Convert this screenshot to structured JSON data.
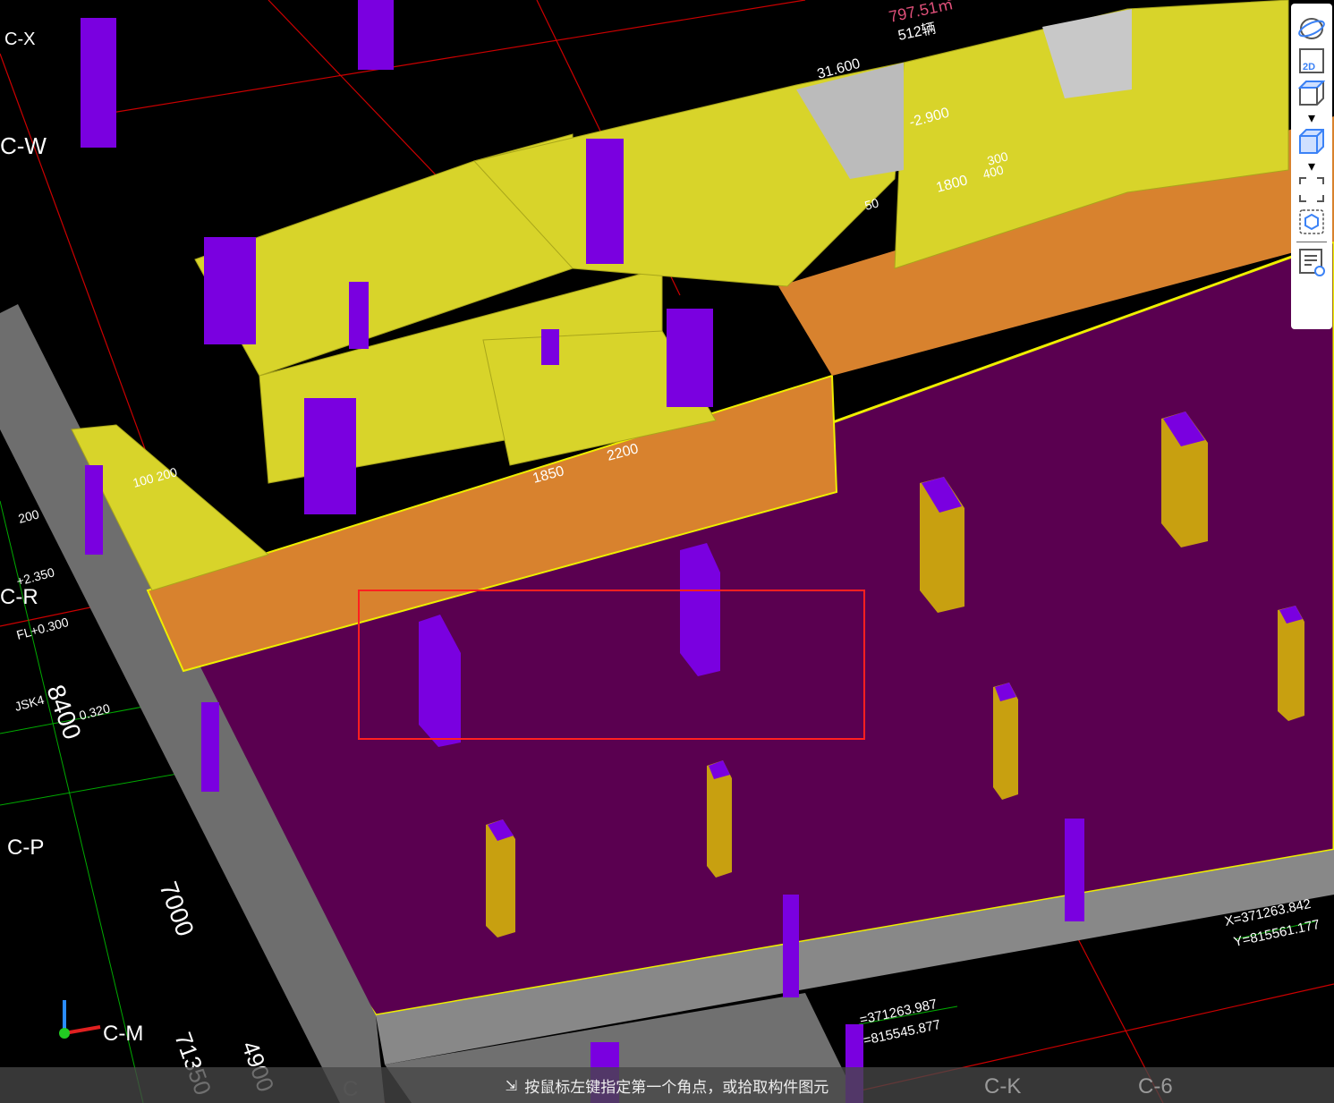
{
  "viewport": {
    "grid_labels": [
      "C-W",
      "C-R",
      "C-P",
      "C-M",
      "C-K",
      "C-6",
      "C-X",
      "C"
    ],
    "dimensions": [
      "8400",
      "7000",
      "71350",
      "4900",
      "1800",
      "1850",
      "2200",
      "300",
      "400",
      "200",
      "100 200",
      "50",
      "-2.900",
      "31.600"
    ],
    "annotations": {
      "area": "797.51㎡",
      "count": "512辆",
      "level": "FL+0.300",
      "level2": "0.320",
      "tag": "JSK4",
      "elev": "+2.350",
      "coord1_x": "X=371263.842",
      "coord1_y": "Y=815561.177",
      "coord2_x": "=371263.987",
      "coord2_y": "=815545.877"
    },
    "colors": {
      "background": "#000000",
      "slab": "#5a0050",
      "wall_yellow": "#d8d42a",
      "wall_orange": "#d8822e",
      "column_purple": "#7a00e0",
      "column_gold": "#c8a010",
      "wall_gray": "#7a7a7a",
      "selection": "#ff2020"
    }
  },
  "toolbar": {
    "items": [
      {
        "name": "orbit-icon"
      },
      {
        "name": "2d-view-icon",
        "label": "2D"
      },
      {
        "name": "3d-wireframe-icon"
      },
      {
        "name": "3d-solid-icon"
      },
      {
        "name": "zoom-extents-icon"
      },
      {
        "name": "component-view-icon"
      },
      {
        "name": "display-settings-icon"
      }
    ]
  },
  "status_bar": {
    "prompt": "按鼠标左键指定第一个角点，或拾取构件图元"
  }
}
